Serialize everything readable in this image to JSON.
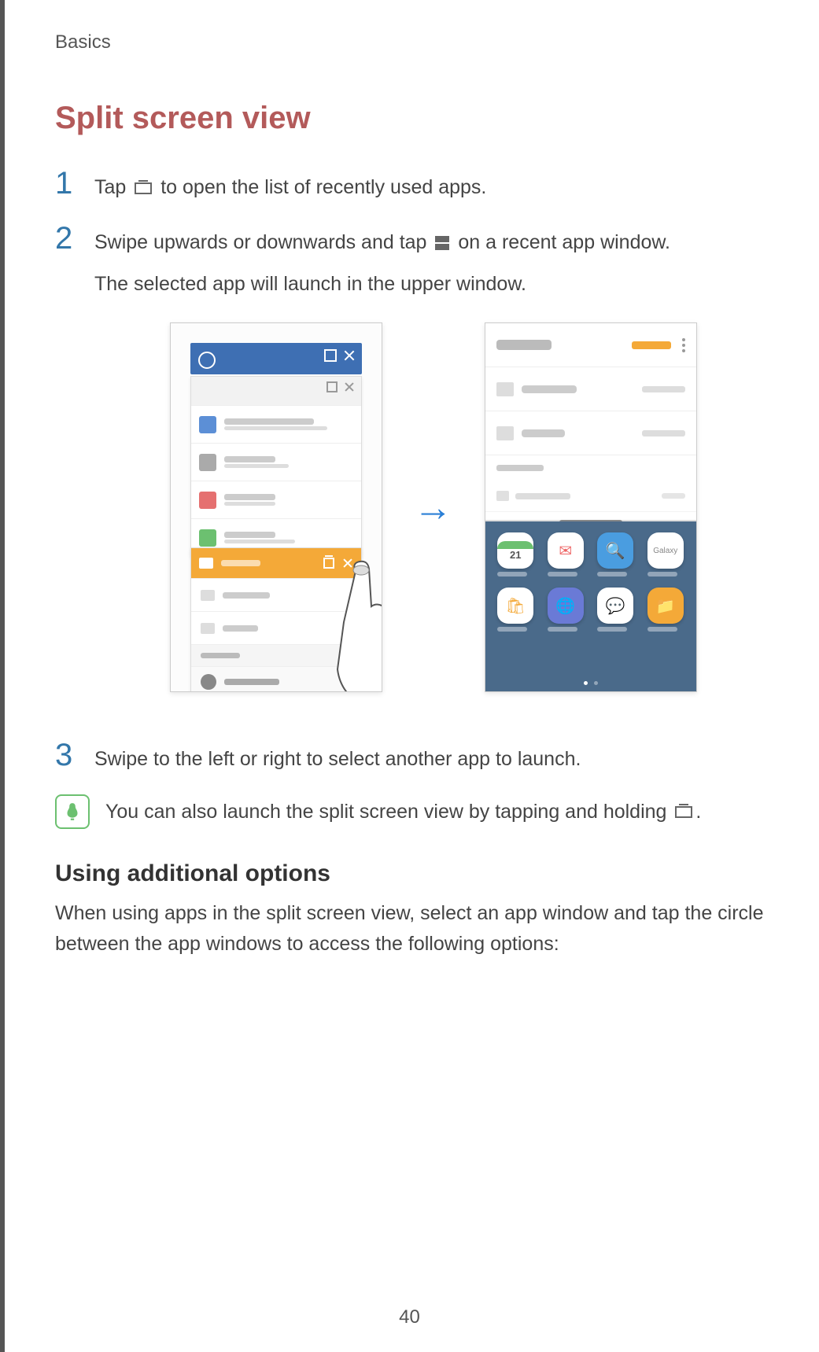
{
  "breadcrumb": "Basics",
  "title": "Split screen view",
  "steps": {
    "1": {
      "num": "1",
      "text_before": "Tap ",
      "text_after": " to open the list of recently used apps."
    },
    "2": {
      "num": "2",
      "text_before": "Swipe upwards or downwards and tap ",
      "text_after": " on a recent app window.",
      "subline": "The selected app will launch in the upper window."
    },
    "3": {
      "num": "3",
      "text": "Swipe to the left or right to select another app to launch."
    }
  },
  "note": {
    "text_before": "You can also launch the split screen view by tapping and holding ",
    "text_after": "."
  },
  "subheading": "Using additional options",
  "body": "When using apps in the split screen view, select an app window and tap the circle between the app windows to access the following options:",
  "page_number": "40",
  "illustration": {
    "calendar_day": "21",
    "galaxy_label": "Galaxy"
  }
}
